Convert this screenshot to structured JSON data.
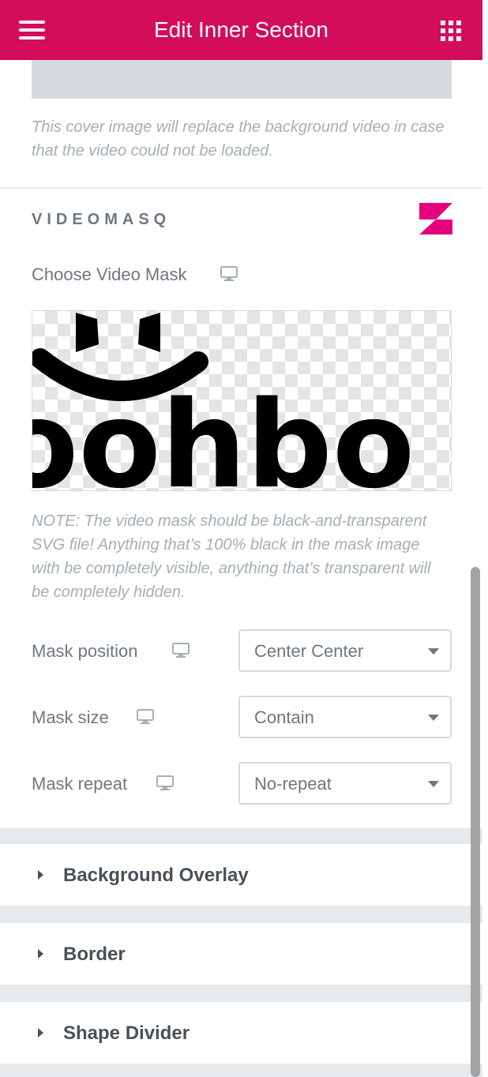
{
  "header": {
    "title": "Edit Inner Section",
    "menu_icon": "hamburger-menu-icon",
    "widgets_icon": "apps-grid-icon",
    "background_color": "#d30c5c"
  },
  "background_video": {
    "cover_note": "This cover image will replace the background video in case that the video could not be loaded."
  },
  "videomasq": {
    "section_title": "VIDEOMASQ",
    "brand_color": "#e6007e",
    "choose_mask_label": "Choose Video Mask",
    "responsive_icon": "desktop-monitor-icon",
    "mask_preview_text": "oohbo",
    "mask_note": "NOTE: The video mask should be black-and-transparent SVG file! Anything that’s 100% black in the mask image with be completely visible, anything that’s transparent will be completely hidden.",
    "controls": [
      {
        "label": "Mask position",
        "value": "Center Center"
      },
      {
        "label": "Mask size",
        "value": "Contain"
      },
      {
        "label": "Mask repeat",
        "value": "No-repeat"
      }
    ]
  },
  "panels": [
    {
      "label": "Background Overlay"
    },
    {
      "label": "Border"
    },
    {
      "label": "Shape Divider"
    }
  ]
}
